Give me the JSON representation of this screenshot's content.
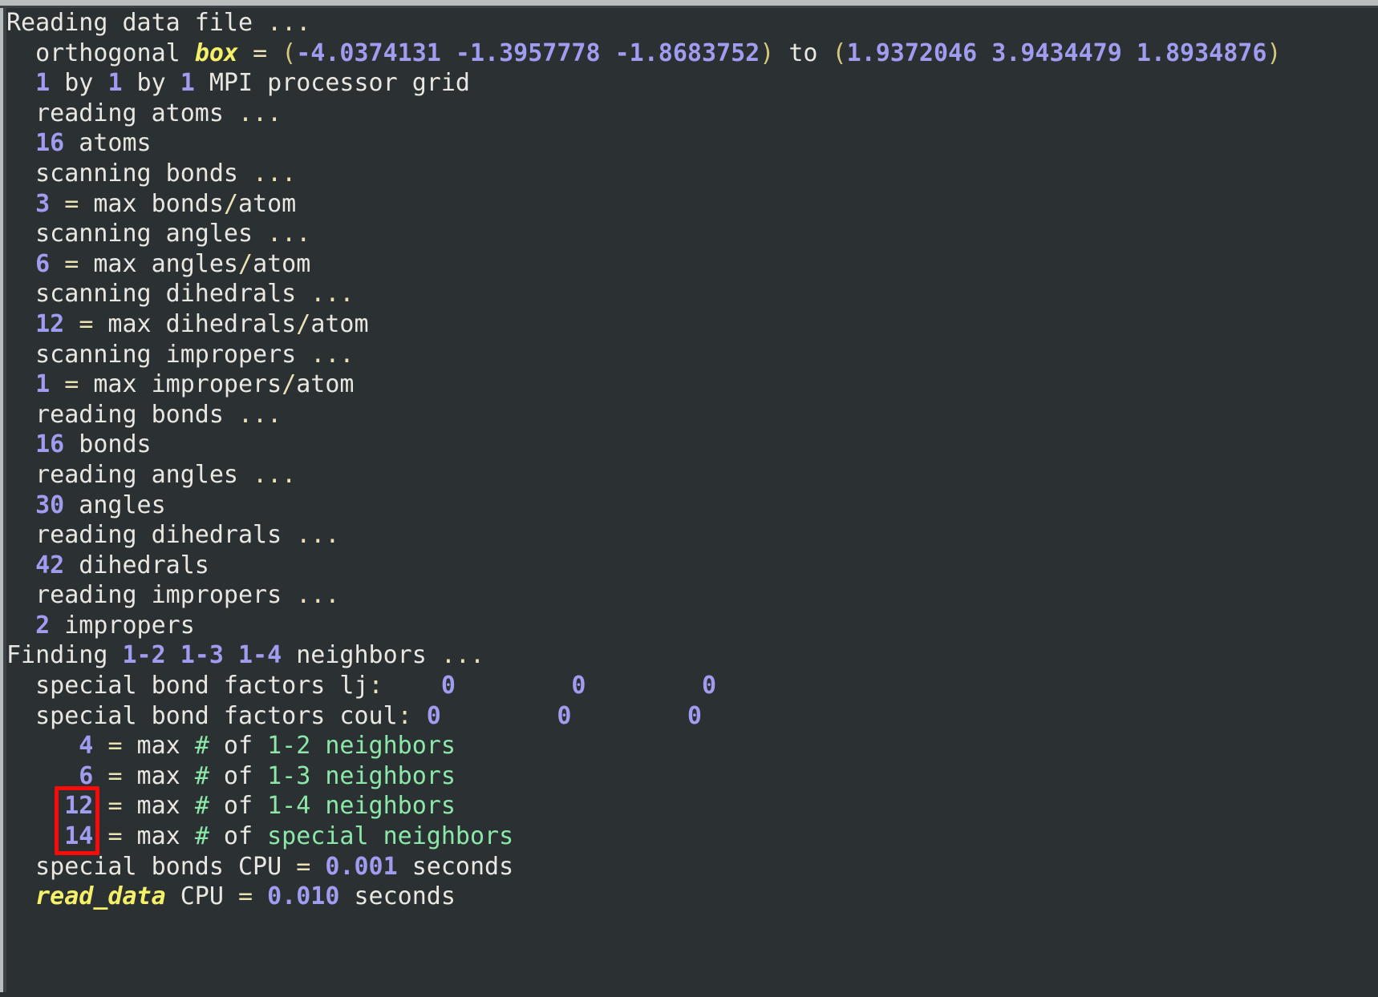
{
  "window": {
    "background_color": "#2b3033",
    "foreground_color": "#e9e7e1",
    "chrome_color": "#b9bdbe"
  },
  "colors": {
    "number": "#a09cf0",
    "operator": "#ebe3b4",
    "keyword": "#f5f06a",
    "green": "#8ce8a8",
    "highlight": "#fb0a0a"
  },
  "highlight": {
    "name": "max-neighbors-column-highlight",
    "shape": "rectangle",
    "color": "#fb0a0a",
    "covers_values": [
      "4",
      "6",
      "12",
      "14"
    ]
  },
  "console": {
    "lines": [
      {
        "id": "line-reading-data-file",
        "indent": 0,
        "tokens": [
          {
            "text": "Reading data file ",
            "style": "plain"
          },
          {
            "text": "...",
            "style": "dots"
          }
        ]
      },
      {
        "id": "line-orthogonal-box",
        "indent": 2,
        "tokens": [
          {
            "text": "orthogonal ",
            "style": "plain"
          },
          {
            "text": "box",
            "style": "kw"
          },
          {
            "text": " ",
            "style": "plain"
          },
          {
            "text": "=",
            "style": "op"
          },
          {
            "text": " ",
            "style": "plain"
          },
          {
            "text": "(",
            "style": "paren"
          },
          {
            "text": "-4.0374131 -1.3957778 -1.8683752",
            "style": "num"
          },
          {
            "text": ")",
            "style": "paren"
          },
          {
            "text": " to ",
            "style": "plain"
          },
          {
            "text": "(",
            "style": "paren"
          },
          {
            "text": "1.9372046 3.9434479 1.8934876",
            "style": "num"
          },
          {
            "text": ")",
            "style": "paren"
          }
        ]
      },
      {
        "id": "line-mpi-grid",
        "indent": 2,
        "tokens": [
          {
            "text": "1",
            "style": "num"
          },
          {
            "text": " by ",
            "style": "plain"
          },
          {
            "text": "1",
            "style": "num"
          },
          {
            "text": " by ",
            "style": "plain"
          },
          {
            "text": "1",
            "style": "num"
          },
          {
            "text": " MPI processor grid",
            "style": "plain"
          }
        ]
      },
      {
        "id": "line-reading-atoms",
        "indent": 2,
        "tokens": [
          {
            "text": "reading atoms ",
            "style": "plain"
          },
          {
            "text": "...",
            "style": "dots"
          }
        ]
      },
      {
        "id": "line-atoms-count",
        "indent": 2,
        "tokens": [
          {
            "text": "16",
            "style": "num"
          },
          {
            "text": " atoms",
            "style": "plain"
          }
        ]
      },
      {
        "id": "line-scanning-bonds",
        "indent": 2,
        "tokens": [
          {
            "text": "scanning bonds ",
            "style": "plain"
          },
          {
            "text": "...",
            "style": "dots"
          }
        ]
      },
      {
        "id": "line-max-bonds-per-atom",
        "indent": 2,
        "tokens": [
          {
            "text": "3",
            "style": "num"
          },
          {
            "text": " ",
            "style": "plain"
          },
          {
            "text": "=",
            "style": "op"
          },
          {
            "text": " max bonds",
            "style": "plain"
          },
          {
            "text": "/",
            "style": "op"
          },
          {
            "text": "atom",
            "style": "plain"
          }
        ]
      },
      {
        "id": "line-scanning-angles",
        "indent": 2,
        "tokens": [
          {
            "text": "scanning angles ",
            "style": "plain"
          },
          {
            "text": "...",
            "style": "dots"
          }
        ]
      },
      {
        "id": "line-max-angles-per-atom",
        "indent": 2,
        "tokens": [
          {
            "text": "6",
            "style": "num"
          },
          {
            "text": " ",
            "style": "plain"
          },
          {
            "text": "=",
            "style": "op"
          },
          {
            "text": " max angles",
            "style": "plain"
          },
          {
            "text": "/",
            "style": "op"
          },
          {
            "text": "atom",
            "style": "plain"
          }
        ]
      },
      {
        "id": "line-scanning-dihedrals",
        "indent": 2,
        "tokens": [
          {
            "text": "scanning dihedrals ",
            "style": "plain"
          },
          {
            "text": "...",
            "style": "dots"
          }
        ]
      },
      {
        "id": "line-max-dihedrals-per-atom",
        "indent": 2,
        "tokens": [
          {
            "text": "12",
            "style": "num"
          },
          {
            "text": " ",
            "style": "plain"
          },
          {
            "text": "=",
            "style": "op"
          },
          {
            "text": " max dihedrals",
            "style": "plain"
          },
          {
            "text": "/",
            "style": "op"
          },
          {
            "text": "atom",
            "style": "plain"
          }
        ]
      },
      {
        "id": "line-scanning-impropers",
        "indent": 2,
        "tokens": [
          {
            "text": "scanning impropers ",
            "style": "plain"
          },
          {
            "text": "...",
            "style": "dots"
          }
        ]
      },
      {
        "id": "line-max-impropers-per-atom",
        "indent": 2,
        "tokens": [
          {
            "text": "1",
            "style": "num"
          },
          {
            "text": " ",
            "style": "plain"
          },
          {
            "text": "=",
            "style": "op"
          },
          {
            "text": " max impropers",
            "style": "plain"
          },
          {
            "text": "/",
            "style": "op"
          },
          {
            "text": "atom",
            "style": "plain"
          }
        ]
      },
      {
        "id": "line-reading-bonds",
        "indent": 2,
        "tokens": [
          {
            "text": "reading bonds ",
            "style": "plain"
          },
          {
            "text": "...",
            "style": "dots"
          }
        ]
      },
      {
        "id": "line-bonds-count",
        "indent": 2,
        "tokens": [
          {
            "text": "16",
            "style": "num"
          },
          {
            "text": " bonds",
            "style": "plain"
          }
        ]
      },
      {
        "id": "line-reading-angles",
        "indent": 2,
        "tokens": [
          {
            "text": "reading angles ",
            "style": "plain"
          },
          {
            "text": "...",
            "style": "dots"
          }
        ]
      },
      {
        "id": "line-angles-count",
        "indent": 2,
        "tokens": [
          {
            "text": "30",
            "style": "num"
          },
          {
            "text": " angles",
            "style": "plain"
          }
        ]
      },
      {
        "id": "line-reading-dihedrals",
        "indent": 2,
        "tokens": [
          {
            "text": "reading dihedrals ",
            "style": "plain"
          },
          {
            "text": "...",
            "style": "dots"
          }
        ]
      },
      {
        "id": "line-dihedrals-count",
        "indent": 2,
        "tokens": [
          {
            "text": "42",
            "style": "num"
          },
          {
            "text": " dihedrals",
            "style": "plain"
          }
        ]
      },
      {
        "id": "line-reading-impropers",
        "indent": 2,
        "tokens": [
          {
            "text": "reading impropers ",
            "style": "plain"
          },
          {
            "text": "...",
            "style": "dots"
          }
        ]
      },
      {
        "id": "line-impropers-count",
        "indent": 2,
        "tokens": [
          {
            "text": "2",
            "style": "num"
          },
          {
            "text": " impropers",
            "style": "plain"
          }
        ]
      },
      {
        "id": "line-finding-neighbors",
        "indent": 0,
        "tokens": [
          {
            "text": "Finding ",
            "style": "plain"
          },
          {
            "text": "1-2",
            "style": "num"
          },
          {
            "text": " ",
            "style": "plain"
          },
          {
            "text": "1-3",
            "style": "num"
          },
          {
            "text": " ",
            "style": "plain"
          },
          {
            "text": "1-4",
            "style": "num"
          },
          {
            "text": " neighbors ",
            "style": "plain"
          },
          {
            "text": "...",
            "style": "dots"
          }
        ]
      },
      {
        "id": "line-special-bond-factors-lj",
        "indent": 2,
        "tokens": [
          {
            "text": "special bond factors lj",
            "style": "plain"
          },
          {
            "text": ":",
            "style": "op"
          },
          {
            "text": "    ",
            "style": "plain"
          },
          {
            "text": "0",
            "style": "num"
          },
          {
            "text": "        ",
            "style": "plain"
          },
          {
            "text": "0",
            "style": "num"
          },
          {
            "text": "        ",
            "style": "plain"
          },
          {
            "text": "0",
            "style": "num"
          }
        ]
      },
      {
        "id": "line-special-bond-factors-coul",
        "indent": 2,
        "tokens": [
          {
            "text": "special bond factors coul",
            "style": "plain"
          },
          {
            "text": ":",
            "style": "op"
          },
          {
            "text": " ",
            "style": "plain"
          },
          {
            "text": "0",
            "style": "num"
          },
          {
            "text": "        ",
            "style": "plain"
          },
          {
            "text": "0",
            "style": "num"
          },
          {
            "text": "        ",
            "style": "plain"
          },
          {
            "text": "0",
            "style": "num"
          }
        ]
      },
      {
        "id": "line-max-1-2-neighbors",
        "indent": 4,
        "tokens": [
          {
            "text": " 4",
            "style": "num"
          },
          {
            "text": " ",
            "style": "plain"
          },
          {
            "text": "=",
            "style": "op"
          },
          {
            "text": " max ",
            "style": "plain"
          },
          {
            "text": "#",
            "style": "green"
          },
          {
            "text": " of ",
            "style": "plain"
          },
          {
            "text": "1-2 neighbors",
            "style": "green"
          }
        ]
      },
      {
        "id": "line-max-1-3-neighbors",
        "indent": 4,
        "tokens": [
          {
            "text": " 6",
            "style": "num"
          },
          {
            "text": " ",
            "style": "plain"
          },
          {
            "text": "=",
            "style": "op"
          },
          {
            "text": " max ",
            "style": "plain"
          },
          {
            "text": "#",
            "style": "green"
          },
          {
            "text": " of ",
            "style": "plain"
          },
          {
            "text": "1-3 neighbors",
            "style": "green"
          }
        ]
      },
      {
        "id": "line-max-1-4-neighbors",
        "indent": 4,
        "tokens": [
          {
            "text": "12",
            "style": "num"
          },
          {
            "text": " ",
            "style": "plain"
          },
          {
            "text": "=",
            "style": "op"
          },
          {
            "text": " max ",
            "style": "plain"
          },
          {
            "text": "#",
            "style": "green"
          },
          {
            "text": " of ",
            "style": "plain"
          },
          {
            "text": "1-4 neighbors",
            "style": "green"
          }
        ]
      },
      {
        "id": "line-max-special-neighbors",
        "indent": 4,
        "tokens": [
          {
            "text": "14",
            "style": "num"
          },
          {
            "text": " ",
            "style": "plain"
          },
          {
            "text": "=",
            "style": "op"
          },
          {
            "text": " max ",
            "style": "plain"
          },
          {
            "text": "#",
            "style": "green"
          },
          {
            "text": " of ",
            "style": "plain"
          },
          {
            "text": "special neighbors",
            "style": "green"
          }
        ]
      },
      {
        "id": "line-special-bonds-cpu",
        "indent": 2,
        "tokens": [
          {
            "text": "special bonds CPU ",
            "style": "plain"
          },
          {
            "text": "=",
            "style": "op"
          },
          {
            "text": " ",
            "style": "plain"
          },
          {
            "text": "0.001",
            "style": "num"
          },
          {
            "text": " seconds",
            "style": "plain"
          }
        ]
      },
      {
        "id": "line-read-data-cpu",
        "indent": 2,
        "tokens": [
          {
            "text": "read_data",
            "style": "kw"
          },
          {
            "text": " CPU ",
            "style": "plain"
          },
          {
            "text": "=",
            "style": "op"
          },
          {
            "text": " ",
            "style": "plain"
          },
          {
            "text": "0.010",
            "style": "num"
          },
          {
            "text": " seconds",
            "style": "plain"
          }
        ]
      }
    ]
  }
}
